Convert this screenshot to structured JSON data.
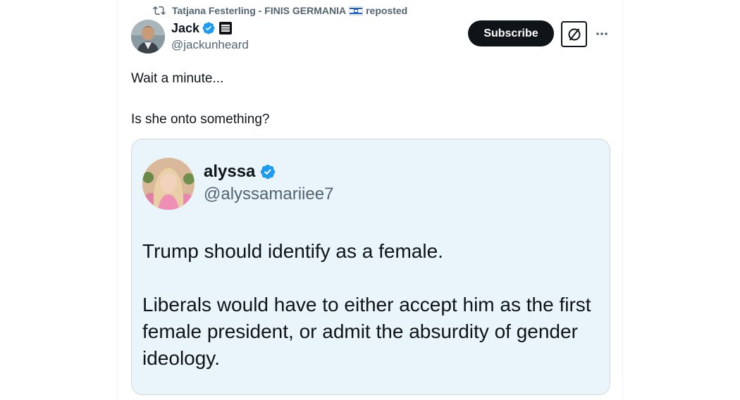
{
  "repost": {
    "user": "Tatjana Festerling - FINIS GERMANIA",
    "flag": "israel-flag",
    "action": "reposted"
  },
  "author": {
    "name": "Jack",
    "handle": "@jackunheard",
    "verified": true,
    "affiliate_badge": "organization-affiliate-badge"
  },
  "actions": {
    "subscribe_label": "Subscribe",
    "grok_icon": "grok-icon",
    "more_icon": "more-options-icon"
  },
  "tweet": {
    "lines": [
      "Wait a minute...",
      "Is she onto something?"
    ]
  },
  "quoted": {
    "name": "alyssa",
    "handle": "@alyssamariiee7",
    "verified": true,
    "paragraphs": [
      "Trump should identify as a female.",
      "Liberals would have to either accept him as the first female president, or admit the absurdity of gender ideology."
    ]
  },
  "colors": {
    "text_primary": "#0f1419",
    "text_secondary": "#536471",
    "verified_blue": "#1d9bf0",
    "button_dark": "#0f1419",
    "card_background": "#eaf4fb"
  }
}
